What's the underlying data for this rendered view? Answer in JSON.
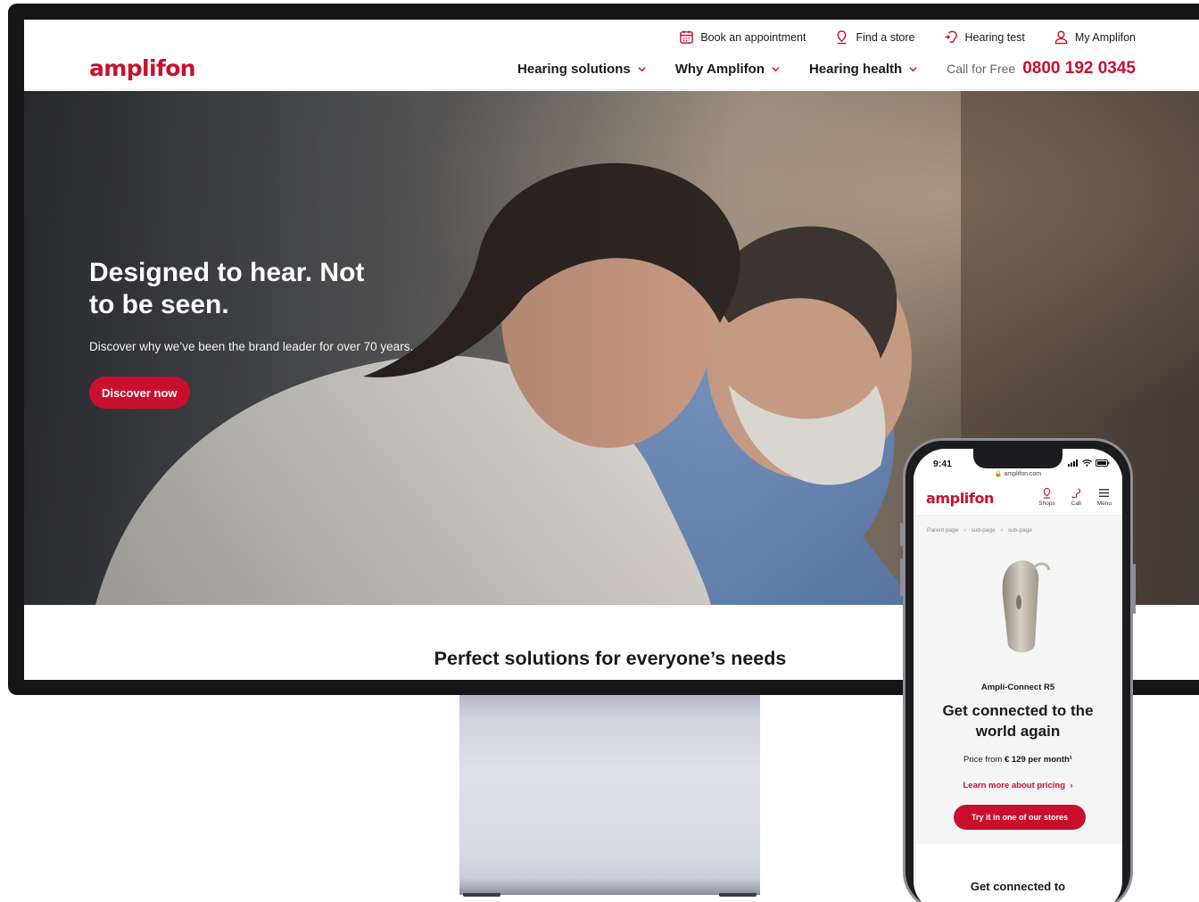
{
  "desktop": {
    "brand": "amplifon",
    "top_links": [
      {
        "icon": "calendar-icon",
        "label": "Book an appointment"
      },
      {
        "icon": "location-pin-icon",
        "label": "Find a store"
      },
      {
        "icon": "hearing-test-icon",
        "label": "Hearing test"
      },
      {
        "icon": "user-icon",
        "label": "My Amplifon"
      }
    ],
    "nav": [
      {
        "label": "Hearing solutions"
      },
      {
        "label": "Why Amplifon"
      },
      {
        "label": "Hearing health"
      }
    ],
    "call_label": "Call for Free",
    "call_number": "0800 192 0345",
    "hero": {
      "title": "Designed to hear. Not to be seen.",
      "subtitle": "Discover why we’ve been the brand leader for over 70 years.",
      "button": "Discover now"
    },
    "section_title": "Perfect solutions for everyone’s needs"
  },
  "mobile": {
    "time": "9:41",
    "url": "amplifon.com",
    "brand": "amplifon",
    "actions": [
      {
        "icon": "location-pin-icon",
        "label": "Shops"
      },
      {
        "icon": "phone-icon",
        "label": "Call"
      },
      {
        "icon": "menu-icon",
        "label": "Menu"
      }
    ],
    "breadcrumb": [
      "Parent page",
      "sub-page",
      "sub-page"
    ],
    "product_name": "Ampli-Connect R5",
    "title": "Get connected to the world again",
    "price_prefix": "Price from",
    "price_value": "€ 129 per month¹",
    "pricing_link": "Learn more about pricing",
    "button": "Try it in one of our stores",
    "section_title": "Get connected to"
  },
  "colors": {
    "brand_red": "#c8102e",
    "text_dark": "#1a1a1a"
  }
}
